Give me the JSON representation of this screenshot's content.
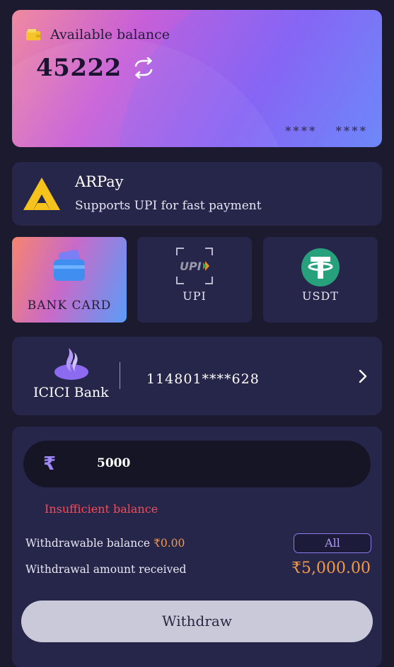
{
  "balance": {
    "label": "Available balance",
    "amount": "45222",
    "mask_1": "****",
    "mask_2": "****"
  },
  "provider": {
    "name": "ARPay",
    "subtitle": "Supports UPI for fast payment"
  },
  "methods": [
    {
      "label": "BANK CARD",
      "icon": "bank-card-icon",
      "active": true
    },
    {
      "label": "UPI",
      "icon": "upi-icon",
      "active": false
    },
    {
      "label": "USDT",
      "icon": "usdt-icon",
      "active": false
    }
  ],
  "bank": {
    "name": "ICICI Bank",
    "account": "114801****628"
  },
  "withdraw": {
    "currency_symbol": "₹",
    "amount": "5000",
    "error": "Insufficient balance",
    "withdrawable_label": "Withdrawable balance ",
    "withdrawable_value": "₹0.00",
    "all_label": "All",
    "received_label": "Withdrawal amount received",
    "received_value": "₹5,000.00",
    "button_label": "Withdraw"
  },
  "colors": {
    "background": "#1b1a2f",
    "panel": "#26254a",
    "accent_orange": "#f39a4a",
    "error_red": "#ef4f5d",
    "accent_purple": "#9f86f5"
  }
}
